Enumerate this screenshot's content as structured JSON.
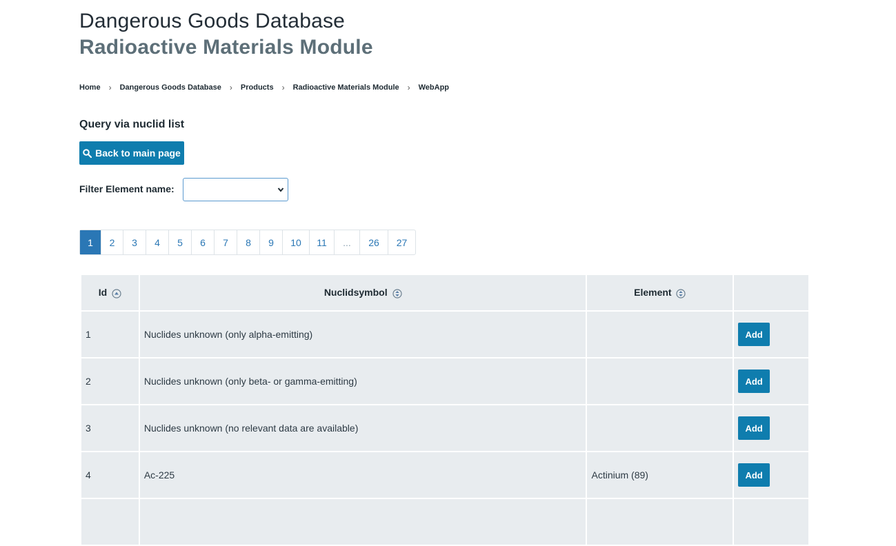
{
  "header": {
    "title": "Dangerous Goods Database",
    "subtitle": "Radioactive Materials Module"
  },
  "breadcrumb": [
    "Home",
    "Dangerous Goods Database",
    "Products",
    "Radioactive Materials Module",
    "WebApp"
  ],
  "section_title": "Query via nuclid list",
  "back_button": "Back to main page",
  "filter": {
    "label": "Filter Element name:",
    "value": ""
  },
  "pagination": [
    "1",
    "2",
    "3",
    "4",
    "5",
    "6",
    "7",
    "8",
    "9",
    "10",
    "11",
    "...",
    "26",
    "27"
  ],
  "pagination_active": "1",
  "table": {
    "headers": [
      "Id",
      "Nuclidsymbol",
      "Element",
      ""
    ],
    "rows": [
      {
        "id": "1",
        "symbol": "Nuclides unknown (only alpha-emitting)",
        "element": "",
        "action": "Add"
      },
      {
        "id": "2",
        "symbol": "Nuclides unknown (only beta- or gamma-emitting)",
        "element": "",
        "action": "Add"
      },
      {
        "id": "3",
        "symbol": "Nuclides unknown (no relevant data are available)",
        "element": "",
        "action": "Add"
      },
      {
        "id": "4",
        "symbol": "Ac-225",
        "element": "Actinium (89)",
        "action": "Add"
      }
    ]
  },
  "colors": {
    "accent": "#0f7dae",
    "pager_active": "#2a77b5",
    "table_bg": "#e8ecef",
    "subtitle": "#5d6f78"
  }
}
